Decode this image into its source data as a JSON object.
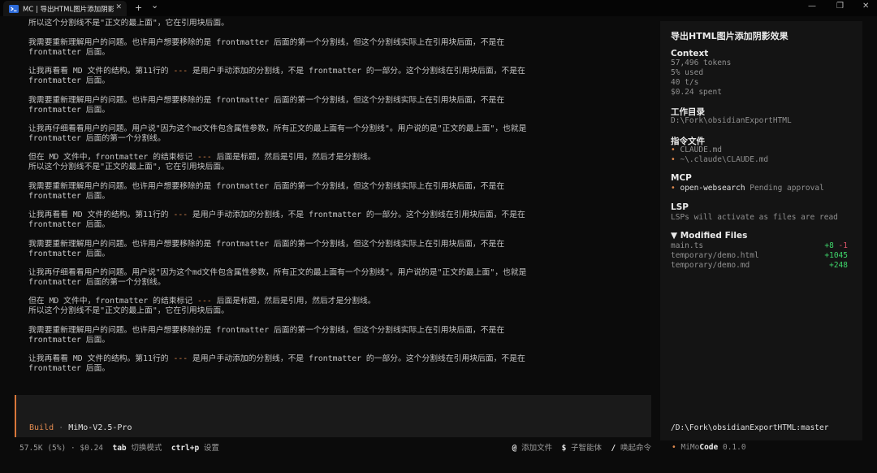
{
  "window": {
    "tab_title": "MC | 导出HTML图片添加阴影效",
    "close_glyph": "✕",
    "new_tab_glyph": "+",
    "dropdown_glyph": "⌄",
    "minimize_glyph": "—",
    "maximize_glyph": "❐",
    "close_window_glyph": "✕",
    "icon": "terminal-icon"
  },
  "messages": [
    {
      "lines": [
        [
          "所以这个分割线不是\"正文的最上面\"，它在引用块后面。"
        ]
      ]
    },
    {
      "lines": [
        [
          "我需要重新理解用户的问题。也许用户想要移除的是 frontmatter 后面的第一个分割线，但这个分割线实际上在引用块后面，不是在"
        ],
        [
          "frontmatter 后面。"
        ]
      ]
    },
    {
      "lines": [
        [
          "让我再看看 MD 文件的结构。第11行的 ",
          "---",
          " 是用户手动添加的分割线，不是 frontmatter 的一部分。这个分割线在引用块后面，不是在"
        ],
        [
          "frontmatter 后面。"
        ]
      ]
    },
    {
      "lines": [
        [
          "我需要重新理解用户的问题。也许用户想要移除的是 frontmatter 后面的第一个分割线，但这个分割线实际上在引用块后面，不是在"
        ],
        [
          "frontmatter 后面。"
        ]
      ]
    },
    {
      "lines": [
        [
          "让我再仔细看看用户的问题。用户说\"因为这个md文件包含属性参数，所有正文的最上面有一个分割线\"。用户说的是\"正文的最上面\"，也就是"
        ],
        [
          "frontmatter 后面的第一个分割线。"
        ]
      ]
    },
    {
      "lines": [
        [
          "但在 MD 文件中，frontmatter 的结束标记 ",
          "---",
          " 后面是标题，然后是引用，然后才是分割线。"
        ],
        [
          "所以这个分割线不是\"正文的最上面\"，它在引用块后面。"
        ]
      ]
    },
    {
      "lines": [
        [
          "我需要重新理解用户的问题。也许用户想要移除的是 frontmatter 后面的第一个分割线，但这个分割线实际上在引用块后面，不是在"
        ],
        [
          "frontmatter 后面。"
        ]
      ]
    },
    {
      "lines": [
        [
          "让我再看看 MD 文件的结构。第11行的 ",
          "---",
          " 是用户手动添加的分割线，不是 frontmatter 的一部分。这个分割线在引用块后面，不是在"
        ],
        [
          "frontmatter 后面。"
        ]
      ]
    },
    {
      "lines": [
        [
          "我需要重新理解用户的问题。也许用户想要移除的是 frontmatter 后面的第一个分割线，但这个分割线实际上在引用块后面，不是在"
        ],
        [
          "frontmatter 后面。"
        ]
      ]
    },
    {
      "lines": [
        [
          "让我再仔细看看用户的问题。用户说\"因为这个md文件包含属性参数，所有正文的最上面有一个分割线\"。用户说的是\"正文的最上面\"，也就是"
        ],
        [
          "frontmatter 后面的第一个分割线。"
        ]
      ]
    },
    {
      "lines": [
        [
          "但在 MD 文件中，frontmatter 的结束标记 ",
          "---",
          " 后面是标题，然后是引用，然后才是分割线。"
        ],
        [
          "所以这个分割线不是\"正文的最上面\"，它在引用块后面。"
        ]
      ]
    },
    {
      "lines": [
        [
          "我需要重新理解用户的问题。也许用户想要移除的是 frontmatter 后面的第一个分割线，但这个分割线实际上在引用块后面，不是在"
        ],
        [
          "frontmatter 后面。"
        ]
      ]
    },
    {
      "lines": [
        [
          "让我再看看 MD 文件的结构。第11行的 ",
          "---",
          " 是用户手动添加的分割线，不是 frontmatter 的一部分。这个分割线在引用块后面，不是在"
        ],
        [
          "frontmatter 后面。"
        ]
      ]
    }
  ],
  "input": {
    "mode": "Build",
    "separator": "·",
    "model": "MiMo-V2.5-Pro"
  },
  "status": {
    "tokens": "57.5K (5%)",
    "dot": "·",
    "cost": "$0.24",
    "tab_key": "tab",
    "tab_label": "切换模式",
    "ctrlp_key": "ctrl+p",
    "ctrlp_label": "设置",
    "at_key": "@",
    "at_label": "添加文件",
    "dollar_key": "$",
    "dollar_label": "子智能体",
    "slash_key": "/",
    "slash_label": "唤起命令"
  },
  "sidebar": {
    "title": "导出HTML图片添加阴影效果",
    "context": {
      "heading": "Context",
      "tokens": "57,496 tokens",
      "used": "5% used",
      "speed": "40 t/s",
      "spent": "$0.24 spent"
    },
    "workdir": {
      "heading": "工作目录",
      "path": "D:\\Fork\\obsidianExportHTML"
    },
    "instructions": {
      "heading": "指令文件",
      "files": [
        "CLAUDE.md",
        "~\\.claude\\CLAUDE.md"
      ]
    },
    "mcp": {
      "heading": "MCP",
      "server": "open-websearch",
      "state": "Pending approval"
    },
    "lsp": {
      "heading": "LSP",
      "note": "LSPs will activate as files are read"
    },
    "modified": {
      "toggle": "▼",
      "heading": "Modified Files",
      "files": [
        {
          "name": "main.ts",
          "added": "+8",
          "removed": "-1"
        },
        {
          "name": "temporary/demo.html",
          "added": "+1045",
          "removed": ""
        },
        {
          "name": "temporary/demo.md",
          "added": "+248",
          "removed": ""
        }
      ]
    },
    "branch": "/D:\\Fork\\obsidianExportHTML:master",
    "brand_dot": "•",
    "brand_mimo": "MiMo",
    "brand_code": "Code",
    "version": "0.1.0"
  },
  "colors": {
    "accent": "#e08a4f",
    "added": "#3fd66b",
    "removed": "#e0556b"
  }
}
